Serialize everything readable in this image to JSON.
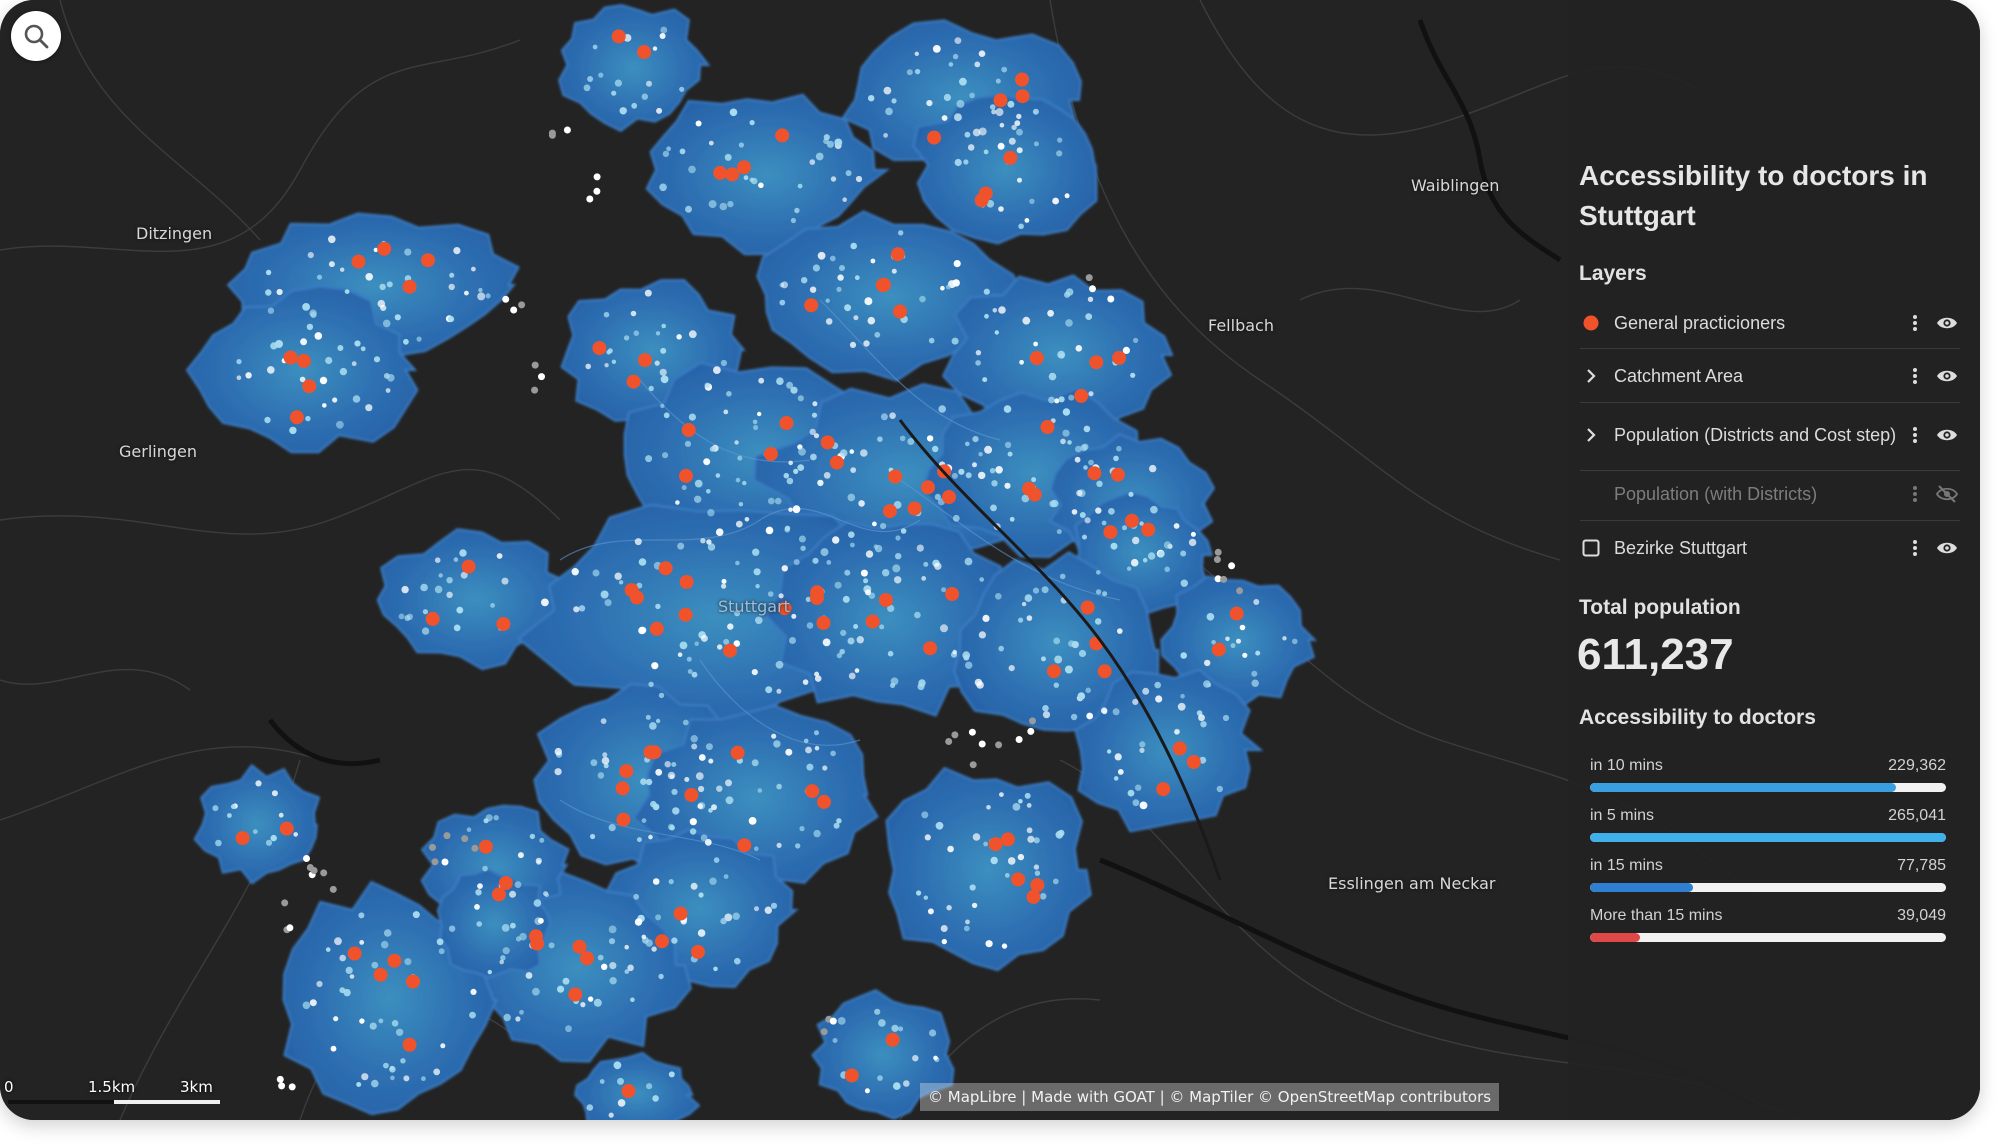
{
  "map": {
    "places": [
      {
        "name": "Ditzingen"
      },
      {
        "name": "Gerlingen"
      },
      {
        "name": "Waiblingen"
      },
      {
        "name": "Fellbach"
      },
      {
        "name": "Stuttgart"
      },
      {
        "name": "Esslingen am Neckar"
      }
    ],
    "scale": {
      "labels": [
        "0",
        "1.5km",
        "3km"
      ]
    },
    "attribution": "© MapLibre | Made with GOAT | © MapTiler © OpenStreetMap contributors",
    "colors": {
      "background": "#232323",
      "catchment": "#2f6fb8",
      "doctor": "#f0532c",
      "population": "#a9dcf0"
    }
  },
  "search": {
    "icon": "search-icon"
  },
  "panel": {
    "title": "Accessibility to doctors in Stuttgart",
    "layers_heading": "Layers",
    "layers": [
      {
        "label": "General practicioners",
        "lead": "dot",
        "lead_color": "#f0532c",
        "visible": true
      },
      {
        "label": "Catchment Area",
        "lead": "chevron",
        "visible": true
      },
      {
        "label": "Population (Districts and Cost step)",
        "lead": "chevron",
        "visible": true
      },
      {
        "label": "Population (with Districts)",
        "lead": "none",
        "visible": false
      },
      {
        "label": "Bezirke Stuttgart",
        "lead": "checkbox",
        "visible": true
      }
    ],
    "total_population": {
      "label": "Total population",
      "value": "611,237"
    },
    "accessibility": {
      "heading": "Accessibility to doctors",
      "rows": [
        {
          "label": "in 10 mins",
          "value": "229,362",
          "fraction": 0.86,
          "color": "#3a9fe0"
        },
        {
          "label": "in 5 mins",
          "value": "265,041",
          "fraction": 1.0,
          "color": "#3fb0ea"
        },
        {
          "label": "in 15 mins",
          "value": "77,785",
          "fraction": 0.29,
          "color": "#2f80d0"
        },
        {
          "label": "More than 15 mins",
          "value": "39,049",
          "fraction": 0.14,
          "color": "#e04848"
        }
      ]
    }
  }
}
